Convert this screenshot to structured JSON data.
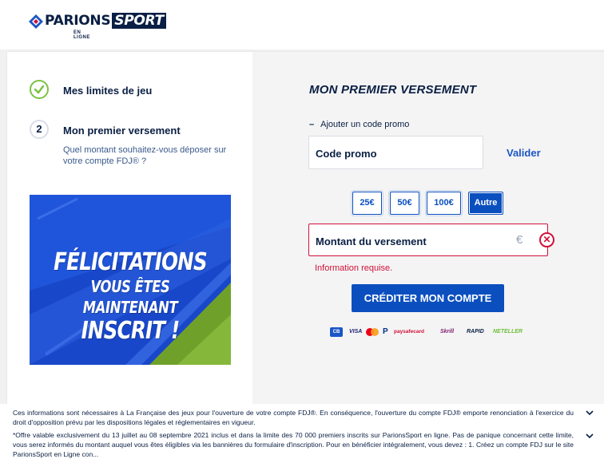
{
  "header": {
    "logo_parions": "PARIONS",
    "logo_sport": "SPORT",
    "logo_sub": "EN LIGNE"
  },
  "steps": [
    {
      "label": "Mes limites de jeu",
      "status": "done"
    },
    {
      "number": "2",
      "label": "Mon premier versement",
      "description": "Quel montant souhaitez-vous déposer sur votre compte FDJ® ?"
    }
  ],
  "promo_banner": {
    "line1": "FÉLICITATIONS",
    "line2": "VOUS ÊTES MAINTENANT",
    "line3": "INSCRIT !"
  },
  "deposit": {
    "title": "MON PREMIER VERSEMENT",
    "promo_toggle_symbol": "–",
    "promo_toggle_label": "Ajouter un code promo",
    "promo_placeholder": "Code promo",
    "validate_label": "Valider",
    "amounts": [
      "25€",
      "50€",
      "100€",
      "Autre"
    ],
    "selected_amount": "Autre",
    "amount_placeholder": "Montant du versement",
    "currency_symbol": "€",
    "error_icon": "✕",
    "error_message": "Information requise.",
    "submit_label": "CRÉDITER MON COMPTE"
  },
  "payment_methods": [
    "CB",
    "VISA",
    "mastercard",
    "PayPal",
    "paysafecard",
    "Skrill",
    "RAPID",
    "NETELLER"
  ],
  "footer": {
    "notice": "Ces informations sont nécessaires à La Française des jeux pour l'ouverture de votre compte FDJ®. En conséquence, l'ouverture du compte FDJ® emporte renonciation à l'exercice du droit d'opposition prévu par les dispositions légales et réglementaires en vigueur.",
    "offer": "*Offre valable exclusivement du 13 juillet au 08 septembre 2021 inclus et dans la limite des 70 000 premiers inscrits sur ParionsSport en ligne. Pas de panique concernant cette limite, vous serez informés du montant auquel vous êtes éligibles via les bannières du formulaire d'inscription. Pour en bénéficier intégralement, vous devez : 1. Créez un compte FDJ sur le site ParionsSport en Ligne con..."
  },
  "colors": {
    "navy": "#0a1f44",
    "primary_blue": "#0b4fbf",
    "error_red": "#d0103a",
    "success_green": "#7cc142"
  }
}
